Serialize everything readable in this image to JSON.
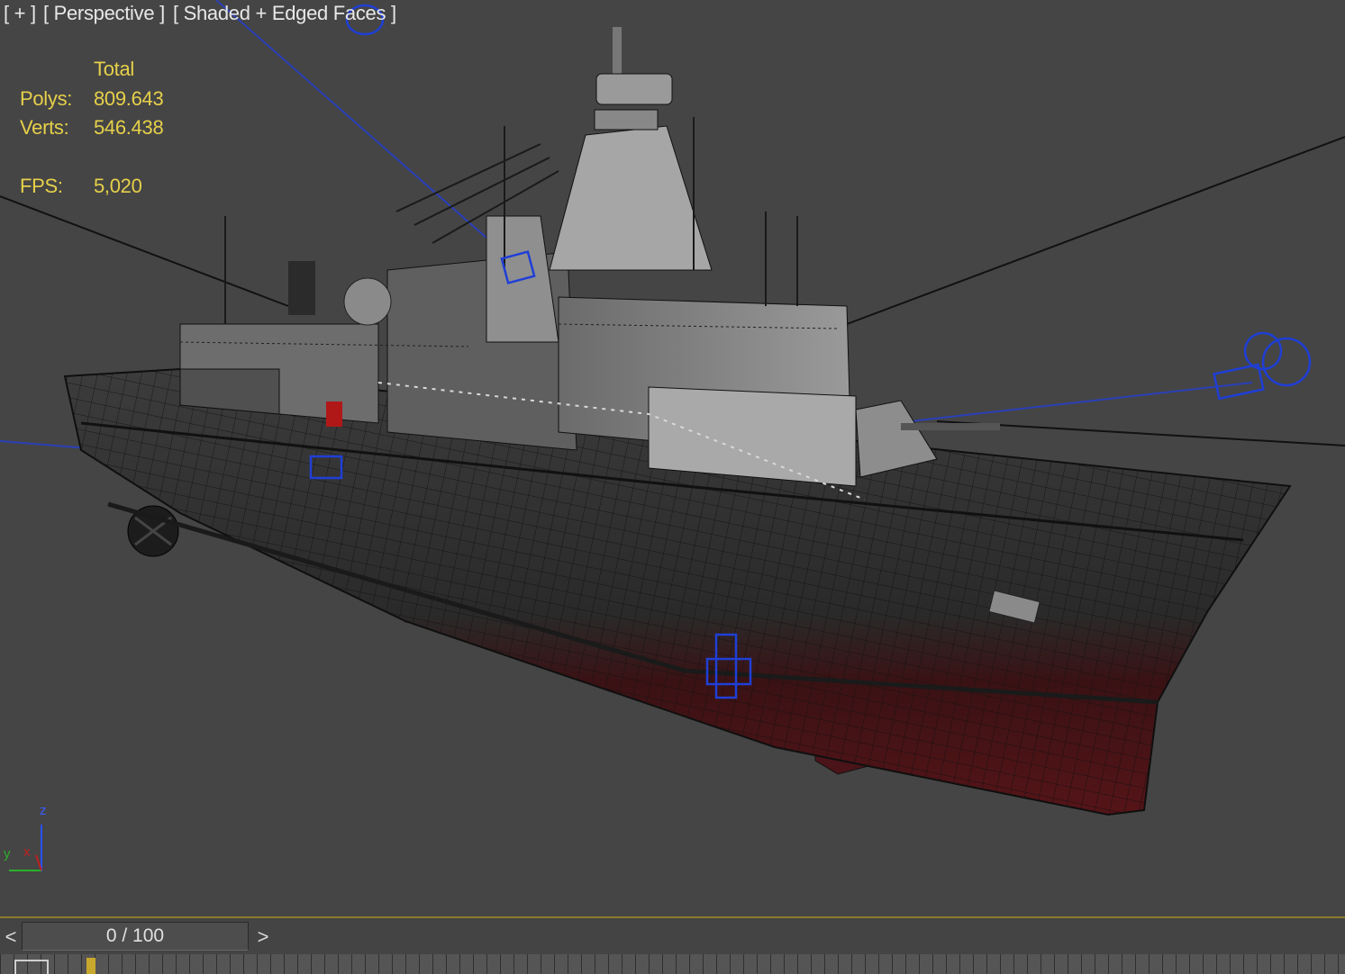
{
  "viewport": {
    "labels": {
      "plus": "[ + ]",
      "view": "[ Perspective ]",
      "shading": "[ Shaded + Edged Faces ]"
    },
    "stats": {
      "header": "Total",
      "polys_label": "Polys:",
      "polys_value": "809.643",
      "verts_label": "Verts:",
      "verts_value": "546.438",
      "fps_label": "FPS:",
      "fps_value": "5,020"
    },
    "axis_gizmo": {
      "z": "z",
      "y": "y",
      "x": "x"
    }
  },
  "timeline": {
    "prev": "<",
    "frame": "0 / 100",
    "next": ">"
  },
  "colors": {
    "viewport_bg": "#454545",
    "stats_text": "#e6d04a",
    "light_objects": "#1f3fd6",
    "hull_top": "#3a3a3a",
    "hull_bottom": "#4a1216"
  }
}
